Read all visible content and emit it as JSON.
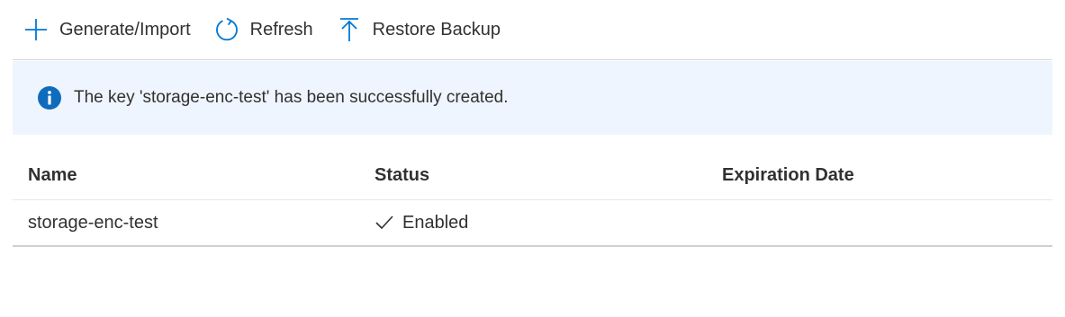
{
  "toolbar": {
    "buttons": [
      {
        "label": "Generate/Import",
        "icon": "plus-icon"
      },
      {
        "label": "Refresh",
        "icon": "refresh-icon"
      },
      {
        "label": "Restore Backup",
        "icon": "upload-icon"
      }
    ]
  },
  "banner": {
    "icon": "info-icon",
    "message": "The key 'storage-enc-test' has been successfully created.",
    "background": "#eef5fe",
    "icon_color": "#0f6cbd"
  },
  "table": {
    "columns": [
      "Name",
      "Status",
      "Expiration Date"
    ],
    "rows": [
      {
        "name": "storage-enc-test",
        "status": "Enabled",
        "status_icon": "check-icon",
        "expiration": ""
      }
    ]
  },
  "colors": {
    "accent": "#0078d4",
    "text": "#323130"
  }
}
